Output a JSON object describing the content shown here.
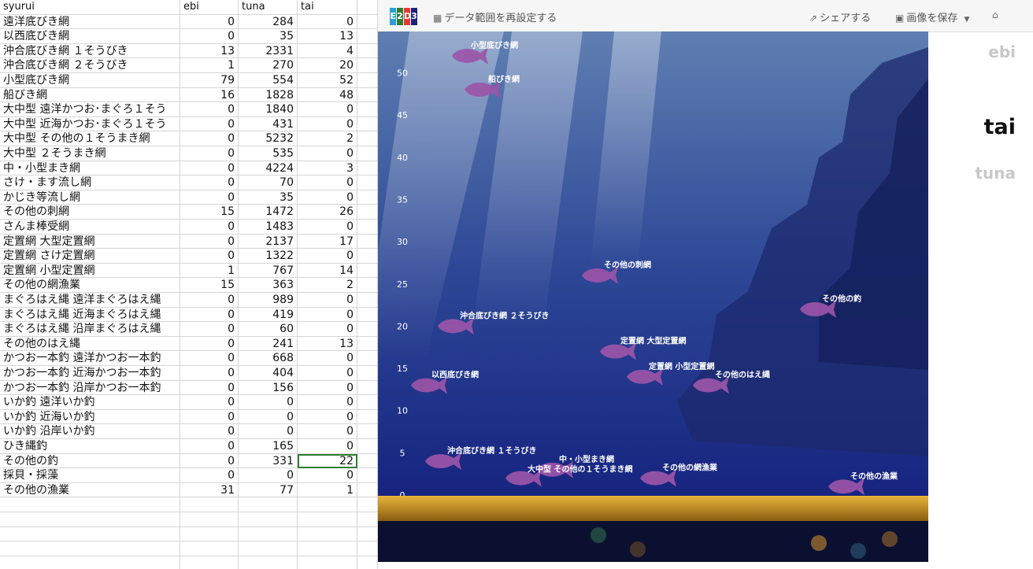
{
  "sheet": {
    "headers": [
      "syurui",
      "ebi",
      "tuna",
      "tai"
    ],
    "rows": [
      [
        "遠洋底びき網",
        "0",
        "284",
        "0"
      ],
      [
        "以西底びき網",
        "0",
        "35",
        "13"
      ],
      [
        "沖合底びき網 １そうびき",
        "13",
        "2331",
        "4"
      ],
      [
        "沖合底びき網 ２そうびき",
        "1",
        "270",
        "20"
      ],
      [
        "小型底びき網",
        "79",
        "554",
        "52"
      ],
      [
        "船びき網",
        "16",
        "1828",
        "48"
      ],
      [
        "大中型 遠洋かつお･まぐろ１そう",
        "0",
        "1840",
        "0"
      ],
      [
        "大中型 近海かつお･まぐろ１そう",
        "0",
        "431",
        "0"
      ],
      [
        "大中型 その他の１そうまき網",
        "0",
        "5232",
        "2"
      ],
      [
        "大中型 ２そうまき網",
        "0",
        "535",
        "0"
      ],
      [
        "中・小型まき網",
        "0",
        "4224",
        "3"
      ],
      [
        "さけ・ます流し網",
        "0",
        "70",
        "0"
      ],
      [
        "かじき等流し網",
        "0",
        "35",
        "0"
      ],
      [
        "その他の刺網",
        "15",
        "1472",
        "26"
      ],
      [
        "さんま棒受網",
        "0",
        "1483",
        "0"
      ],
      [
        "定置網 大型定置網",
        "0",
        "2137",
        "17"
      ],
      [
        "定置網 さけ定置網",
        "0",
        "1322",
        "0"
      ],
      [
        "定置網 小型定置網",
        "1",
        "767",
        "14"
      ],
      [
        "その他の網漁業",
        "15",
        "363",
        "2"
      ],
      [
        "まぐろはえ縄 遠洋まぐろはえ縄",
        "0",
        "989",
        "0"
      ],
      [
        "まぐろはえ縄 近海まぐろはえ縄",
        "0",
        "419",
        "0"
      ],
      [
        "まぐろはえ縄 沿岸まぐろはえ縄",
        "0",
        "60",
        "0"
      ],
      [
        "その他のはえ縄",
        "0",
        "241",
        "13"
      ],
      [
        "かつお一本釣 遠洋かつお一本釣",
        "0",
        "668",
        "0"
      ],
      [
        "かつお一本釣 近海かつお一本釣",
        "0",
        "404",
        "0"
      ],
      [
        "かつお一本釣 沿岸かつお一本釣",
        "0",
        "156",
        "0"
      ],
      [
        "いか釣 遠洋いか釣",
        "0",
        "0",
        "0"
      ],
      [
        "いか釣 近海いか釣",
        "0",
        "0",
        "0"
      ],
      [
        "いか釣 沿岸いか釣",
        "0",
        "0",
        "0"
      ],
      [
        "ひき縄釣",
        "0",
        "165",
        "0"
      ],
      [
        "その他の釣",
        "0",
        "331",
        "22"
      ],
      [
        "採貝・採藻",
        "0",
        "0",
        "0"
      ],
      [
        "その他の漁業",
        "31",
        "77",
        "1"
      ]
    ]
  },
  "toolbar": {
    "logo_letters": [
      "E",
      "2",
      "D",
      "3"
    ],
    "logo_colors": [
      "#2a9fd6",
      "#2e7d32",
      "#e53935",
      "#1a237e"
    ],
    "reset_range_label": "データ範囲を再設定する",
    "share_label": "シェアする",
    "save_image_label": "画像を保存",
    "icons": [
      "table-icon",
      "share-icon",
      "image-icon",
      "caret-down-icon",
      "home-icon"
    ]
  },
  "chart_data": {
    "type": "scatter",
    "title": "",
    "xlabel": "",
    "ylabel": "",
    "ylim": [
      0,
      55
    ],
    "yticks": [
      0,
      5,
      10,
      15,
      20,
      25,
      30,
      35,
      40,
      45,
      50
    ],
    "selected_series": "tai",
    "marker": "fish",
    "marker_color": "#9b55a8",
    "points": [
      {
        "label": "小型底びき網",
        "value": 52
      },
      {
        "label": "船びき網",
        "value": 48
      },
      {
        "label": "その他の刺網",
        "value": 26
      },
      {
        "label": "その他の釣",
        "value": 22
      },
      {
        "label": "沖合底びき網 ２そうびき",
        "value": 20
      },
      {
        "label": "定置網 大型定置網",
        "value": 17
      },
      {
        "label": "定置網 小型定置網",
        "value": 14
      },
      {
        "label": "以西底びき網",
        "value": 13
      },
      {
        "label": "その他のはえ縄",
        "value": 13
      },
      {
        "label": "沖合底びき網 １そうびき",
        "value": 4
      },
      {
        "label": "中・小型まき網",
        "value": 3
      },
      {
        "label": "大中型 その他の１そうまき網",
        "value": 2
      },
      {
        "label": "その他の網漁業",
        "value": 2
      },
      {
        "label": "その他の漁業",
        "value": 1
      }
    ]
  },
  "legend": {
    "items": [
      {
        "label": "ebi",
        "color": "#c8c8c8",
        "size": 20
      },
      {
        "label": "tai",
        "color": "#111111",
        "size": 27
      },
      {
        "label": "tuna",
        "color": "#c8c8c8",
        "size": 20
      }
    ]
  },
  "colors": {
    "sea_top": "#5f7fb2",
    "sea_bottom": "#101a7a",
    "sand": "#d9a12a",
    "selected_cell_border": "#2f7d32"
  }
}
